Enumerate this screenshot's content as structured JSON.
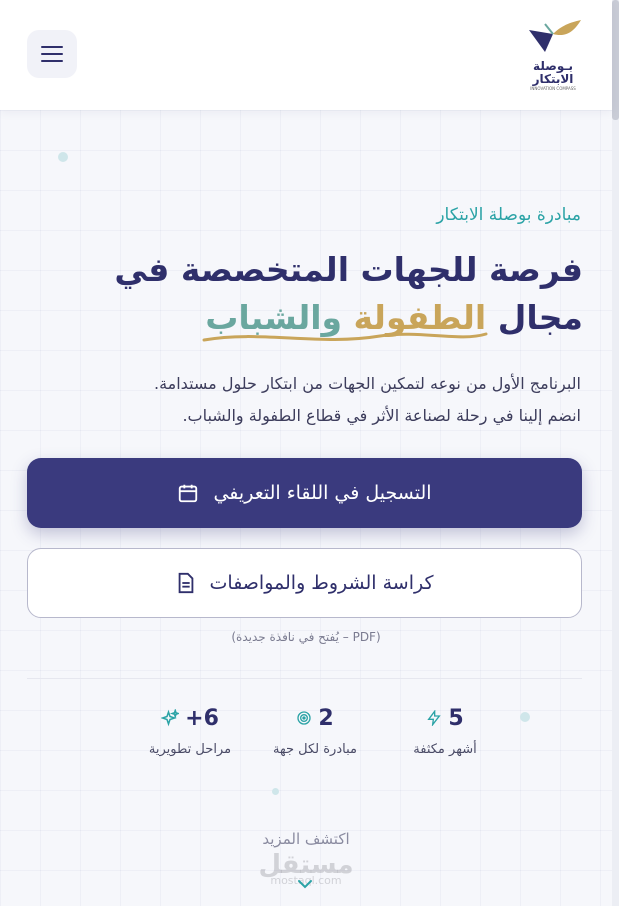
{
  "header": {
    "logo_text_top": "بـوصلة",
    "logo_text_bottom": "الابتكار",
    "logo_subtext": "INNOVATION COMPASS"
  },
  "hero": {
    "eyebrow": "مبادرة بوصلة الابتكار",
    "headline_line1": "فرصة للجهات المتخصصة في",
    "headline_line2_prefix": "مجال",
    "headline_highlight_1": "الطفولة",
    "headline_highlight_2": "والشباب",
    "description_line1": "البرنامج الأول من نوعه لتمكين الجهات من ابتكار حلول مستدامة.",
    "description_line2": "انضم إلينا في رحلة لصناعة الأثر في قطاع الطفولة والشباب."
  },
  "buttons": {
    "register_label": "التسجيل في اللقاء التعريفي",
    "terms_label": "كراسة الشروط والمواصفات",
    "pdf_note": "(PDF – يُفتح في نافذة جديدة)"
  },
  "stats": [
    {
      "value": "5",
      "label": "أشهر مكثفة",
      "icon": "lightning-icon"
    },
    {
      "value": "2",
      "label": "مبادرة لكل جهة",
      "icon": "target-icon"
    },
    {
      "value": "6+",
      "label": "مراحل تطويرية",
      "icon": "sparkles-icon"
    }
  ],
  "discover_label": "اكتشف المزيد",
  "watermark": {
    "text": "مستقل",
    "domain": "mostaql.com"
  },
  "colors": {
    "primary": "#3a3a7e",
    "accent_teal": "#2ba3a6",
    "accent_gold": "#c9a55a",
    "accent_green": "#6aa79f"
  }
}
